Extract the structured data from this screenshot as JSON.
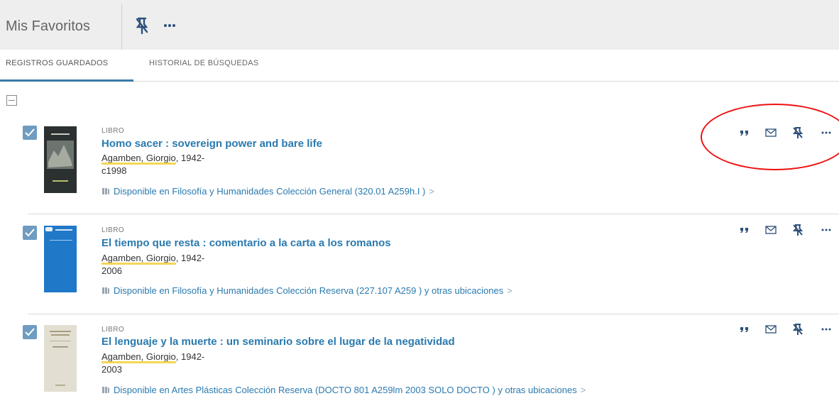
{
  "header": {
    "title": "Mis Favoritos"
  },
  "tabs": [
    {
      "label": "REGISTROS GUARDADOS",
      "active": true
    },
    {
      "label": "HISTORIAL DE BÚSQUEDAS",
      "active": false
    }
  ],
  "records": [
    {
      "type": "LIBRO",
      "title": "Homo sacer : sovereign power and bare life",
      "author_name": "Agamben, Giorgio",
      "author_years": ", 1942-",
      "date": "c1998",
      "availability": "Disponible en Filosofía y Humanidades  Colección General (320.01 A259h.I )",
      "checked": true,
      "cover_color": "#2a2e2f"
    },
    {
      "type": "LIBRO",
      "title": "El tiempo que resta : comentario a la carta a los romanos",
      "author_name": "Agamben, Giorgio",
      "author_years": ", 1942-",
      "date": "2006",
      "availability": "Disponible en Filosofía y Humanidades  Colección Reserva (227.107 A259 ) y otras ubicaciones",
      "checked": true,
      "cover_color": "#1f78c8"
    },
    {
      "type": "LIBRO",
      "title": "El lenguaje y la muerte : un seminario sobre el lugar de la negatividad",
      "author_name": "Agamben, Giorgio",
      "author_years": ", 1942-",
      "date": "2003",
      "availability": "Disponible en Artes Plásticas  Colección Reserva (DOCTO 801 A259lm 2003 SOLO DOCTO ) y otras ubicaciones",
      "checked": true,
      "cover_color": "#dcd9cc"
    }
  ],
  "colors": {
    "accent": "#2a7aaf",
    "checkbox": "#6f9cc0",
    "highlight": "#f3cf3a",
    "annotation": "#e11111"
  },
  "icons": [
    "pin-off-icon",
    "more-icon",
    "quote-icon",
    "mail-icon",
    "book-icon",
    "chevron-right-icon",
    "check-icon"
  ]
}
